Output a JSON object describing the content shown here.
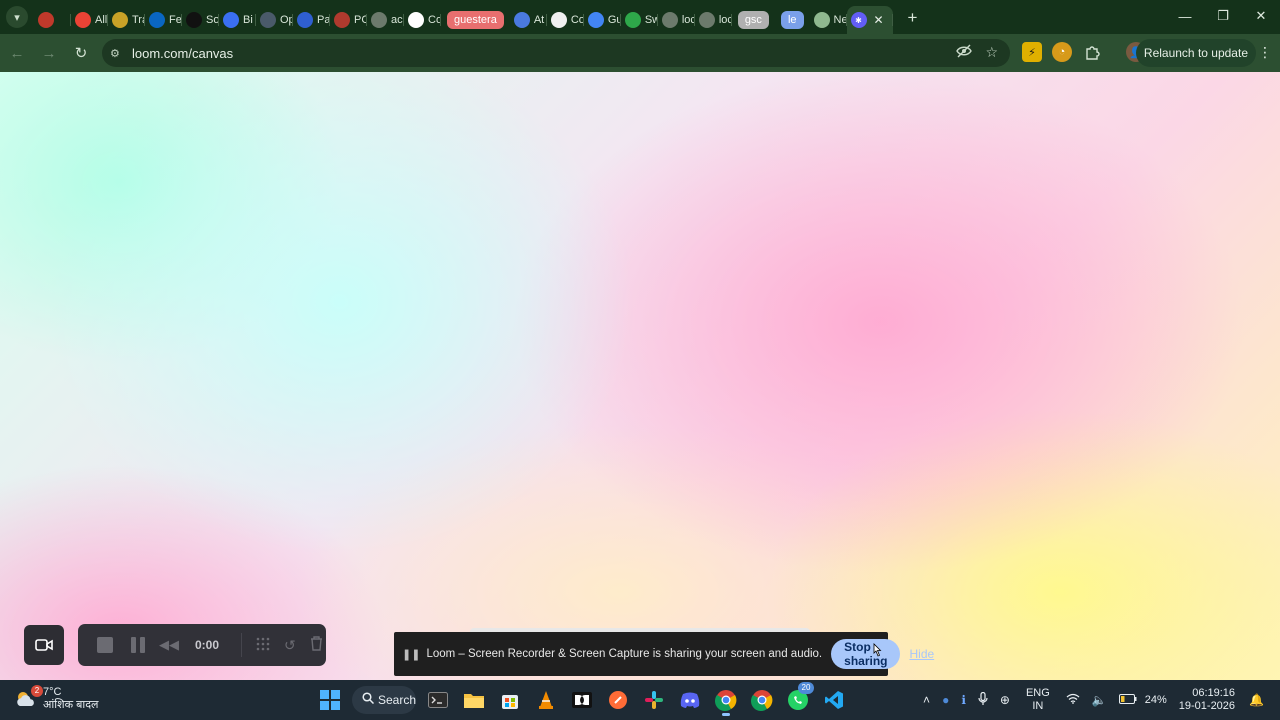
{
  "browser": {
    "tabs": [
      {
        "title": "",
        "favicon": "record-icon",
        "color": "#c0392b"
      },
      {
        "title": "All",
        "favicon": "gmail-icon",
        "color": "#ea4335"
      },
      {
        "title": "Tra",
        "favicon": "star-badge-icon",
        "color": "#c9a227"
      },
      {
        "title": "Fe",
        "favicon": "linkedin-icon",
        "color": "#0a66c2"
      },
      {
        "title": "So",
        "favicon": "m-circle-icon",
        "color": "#111111"
      },
      {
        "title": "Bi",
        "favicon": "triangle-logo-icon",
        "color": "#3a6ff2"
      },
      {
        "title": "Op",
        "favicon": "in-circle-icon",
        "color": "#4a5a6a"
      },
      {
        "title": "Pa",
        "favicon": "k-logo-icon",
        "color": "#2f5fd0"
      },
      {
        "title": "PC",
        "favicon": "document-red-icon",
        "color": "#b03a2e"
      },
      {
        "title": "ac",
        "favicon": "globe-icon",
        "color": "#6c7a6c"
      },
      {
        "title": "Co",
        "favicon": "w-logo-icon",
        "color": "#ffffff"
      }
    ],
    "tab_group": {
      "label": "guestera",
      "color": "#e86f6f"
    },
    "tabs_after_group": [
      {
        "title": "At",
        "favicon": "gear-blue-icon",
        "color": "#4a7ae0"
      },
      {
        "title": "Co",
        "favicon": "github-icon",
        "color": "#f0f0f0"
      },
      {
        "title": "Gu",
        "favicon": "docs-icon",
        "color": "#4285f4"
      },
      {
        "title": "Sw",
        "favicon": "green-logo-icon",
        "color": "#2ea84a"
      },
      {
        "title": "loc",
        "favicon": "globe-icon",
        "color": "#6c7a6c"
      },
      {
        "title": "loc",
        "favicon": "globe-icon",
        "color": "#6c7a6c"
      }
    ],
    "tab_group_2": {
      "label": "gsc",
      "color": "#b0b0b0"
    },
    "tab_group_3": {
      "label": "le",
      "color": "#7aa0ea"
    },
    "tabs_final": [
      {
        "title": "Ne",
        "favicon": "chrome-icon",
        "color": "#8fb88f"
      }
    ],
    "active_tab": {
      "favicon": "loom-icon",
      "color": "#625df5"
    },
    "url": "loom.com/canvas",
    "relaunch_label": "Relaunch to update"
  },
  "recorder": {
    "time": "0:00"
  },
  "share_bar": {
    "message": "Loom – Screen Recorder & Screen Capture is sharing your screen and audio.",
    "stop_label": "Stop sharing",
    "hide_label": "Hide"
  },
  "taskbar": {
    "weather_temp": "7°C",
    "weather_desc": "आंशिक बादल",
    "weather_badge": "2",
    "search_label": "Search",
    "whatsapp_badge": "20",
    "lang_top": "ENG",
    "lang_bottom": "IN",
    "battery": "24%",
    "time": "06:19:16",
    "date": "19-01-2026"
  }
}
